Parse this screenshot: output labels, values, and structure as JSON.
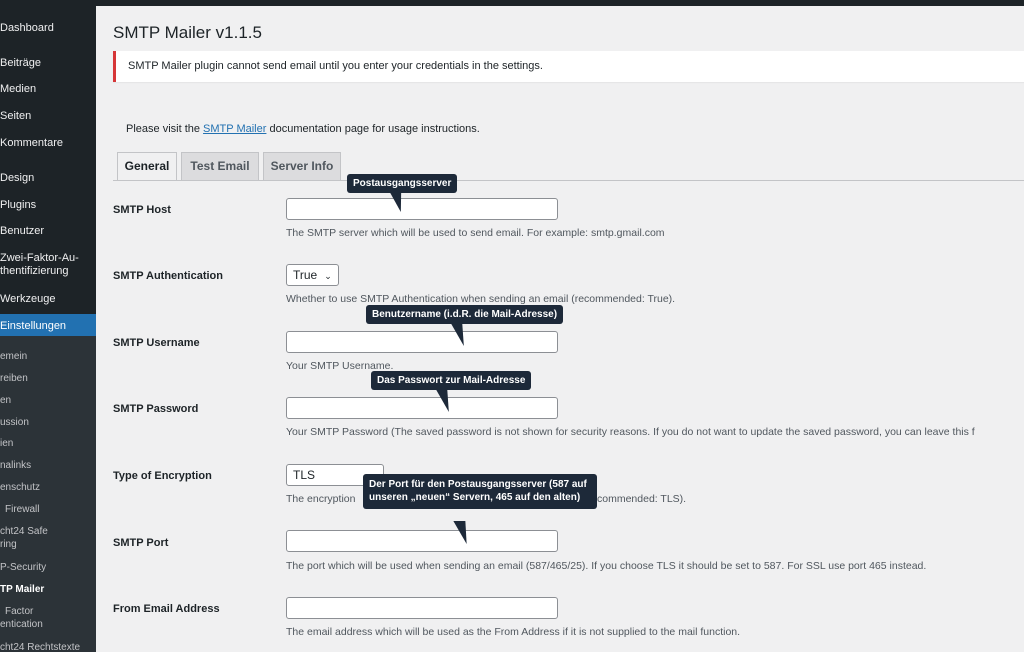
{
  "sidebar": {
    "items": [
      {
        "label": "Dashboard"
      },
      {
        "label": "Beiträge"
      },
      {
        "label": "Medien"
      },
      {
        "label": "Seiten"
      },
      {
        "label": "Kommentare"
      },
      {
        "label": "Design"
      },
      {
        "label": "Plugins"
      },
      {
        "label": "Benutzer"
      },
      {
        "label": "Zwei-Faktor-Au-"
      },
      {
        "label": "thentifizierung"
      },
      {
        "label": "Werkzeuge"
      },
      {
        "label": "Einstellungen"
      }
    ],
    "submenu": [
      {
        "label": "emein"
      },
      {
        "label": "reiben"
      },
      {
        "label": "en"
      },
      {
        "label": "ussion"
      },
      {
        "label": "ien"
      },
      {
        "label": "nalinks"
      },
      {
        "label": "enschutz"
      },
      {
        "label": "Firewall"
      },
      {
        "label": "cht24 Safe"
      },
      {
        "label": "ring"
      },
      {
        "label": "P-Security"
      },
      {
        "label": "TP Mailer"
      },
      {
        "label": "Factor"
      },
      {
        "label": "entication"
      },
      {
        "label": "cht24 Rechtstexte"
      }
    ]
  },
  "page": {
    "title": "SMTP Mailer v1.1.5",
    "notice": "SMTP Mailer plugin cannot send email until you enter your credentials in the settings.",
    "intro_before": "Please visit the ",
    "intro_link": "SMTP Mailer",
    "intro_after": " documentation page for usage instructions."
  },
  "tabs": [
    {
      "label": "General"
    },
    {
      "label": "Test Email"
    },
    {
      "label": "Server Info"
    }
  ],
  "fields": {
    "host": {
      "label": "SMTP Host",
      "value": "",
      "desc": "The SMTP server which will be used to send email. For example: smtp.gmail.com"
    },
    "auth": {
      "label": "SMTP Authentication",
      "value": "True",
      "desc": "Whether to use SMTP Authentication when sending an email (recommended: True)."
    },
    "username": {
      "label": "SMTP Username",
      "value": "",
      "desc": "Your SMTP Username."
    },
    "password": {
      "label": "SMTP Password",
      "value": "",
      "desc": "Your SMTP Password (The saved password is not shown for security reasons. If you do not want to update the saved password, you can leave this f"
    },
    "encryption": {
      "label": "Type of Encryption",
      "value": "TLS",
      "desc_before": "The encryption",
      "desc_after": "commended: TLS)."
    },
    "port": {
      "label": "SMTP Port",
      "value": "",
      "desc": "The port which will be used when sending an email (587/465/25). If you choose TLS it should be set to 587. For SSL use port 465 instead."
    },
    "from": {
      "label": "From Email Address",
      "value": "",
      "desc": "The email address which will be used as the From Address if it is not supplied to the mail function."
    }
  },
  "tooltips": {
    "host": "Postausgangsserver",
    "username": "Benutzername (i.d.R. die Mail-Adresse)",
    "password": "Das Passwort zur Mail-Adresse",
    "port": "Der Port für den Postausgangsserver (587 auf unseren „neuen“ Servern, 465 auf den alten)"
  },
  "icons": {
    "select": "chevron-down-icon"
  },
  "colors": {
    "admin_bar": "#1d2327",
    "active_menu": "#2271b1",
    "notice_error": "#d63638",
    "link": "#2271b1",
    "tooltip_bg": "#1d2939"
  }
}
